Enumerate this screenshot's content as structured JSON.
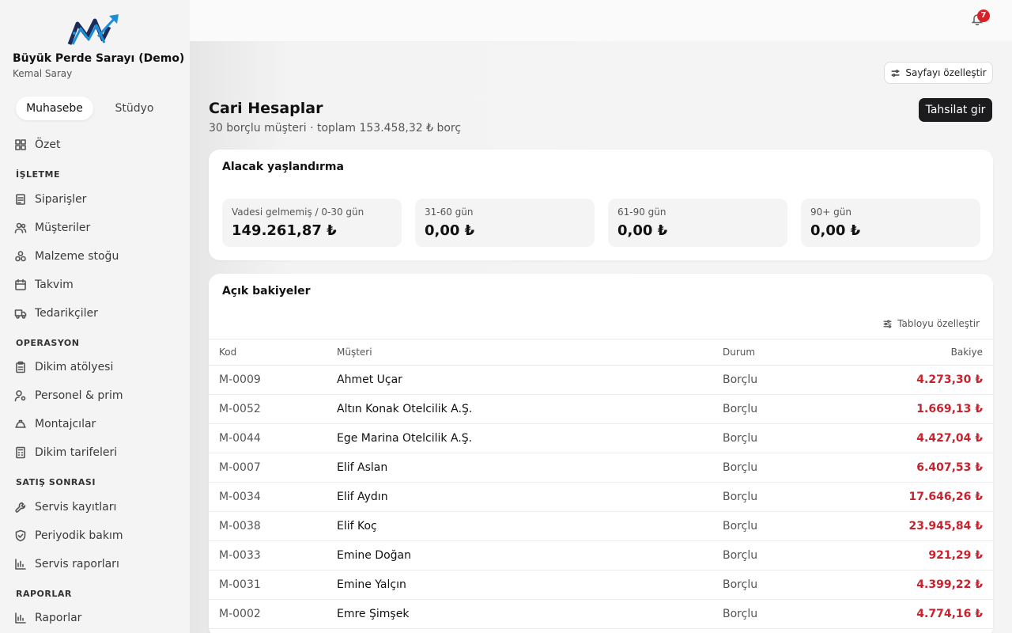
{
  "org": {
    "name": "Büyük Perde Sarayı (Demo)",
    "user": "Kemal Saray"
  },
  "segments": {
    "active": "Muhasebe",
    "inactive": "Stüdyo"
  },
  "nav": {
    "ozet": "Özet",
    "h1": "İŞLETME",
    "siparisler": "Siparişler",
    "musteriler": "Müşteriler",
    "malzeme": "Malzeme stoğu",
    "takvim": "Takvim",
    "tedarikciler": "Tedarikçiler",
    "h2": "OPERASYON",
    "dikim": "Dikim atölyesi",
    "personel": "Personel & prim",
    "montajcilar": "Montajcılar",
    "tarifeler": "Dikim tarifeleri",
    "h3": "SATIŞ SONRASI",
    "servis": "Servis kayıtları",
    "bakim": "Periyodik bakım",
    "raporlar_servis": "Servis raporları",
    "h4": "RAPORLAR",
    "raporlar": "Raporlar"
  },
  "notifications": {
    "count": "7"
  },
  "header": {
    "customize": "Sayfayı özelleştir",
    "title": "Cari Hesaplar",
    "subtitle": "30 borçlu müşteri · toplam 153.458,32 ₺ borç",
    "primary": "Tahsilat gir"
  },
  "aging": {
    "title": "Alacak yaşlandırma",
    "tiles": [
      {
        "label": "Vadesi gelmemiş / 0-30 gün",
        "value": "149.261,87 ₺"
      },
      {
        "label": "31-60 gün",
        "value": "0,00 ₺"
      },
      {
        "label": "61-90 gün",
        "value": "0,00 ₺"
      },
      {
        "label": "90+ gün",
        "value": "0,00 ₺"
      }
    ]
  },
  "balances": {
    "title": "Açık bakiyeler",
    "customize": "Tabloyu özelleştir",
    "columns": {
      "code": "Kod",
      "customer": "Müşteri",
      "status": "Durum",
      "balance": "Bakiye"
    },
    "rows": [
      {
        "code": "M-0009",
        "name": "Ahmet Uçar",
        "status": "Borçlu",
        "balance": "4.273,30 ₺"
      },
      {
        "code": "M-0052",
        "name": "Altın Konak Otelcilik A.Ş.",
        "status": "Borçlu",
        "balance": "1.669,13 ₺"
      },
      {
        "code": "M-0044",
        "name": "Ege Marina Otelcilik A.Ş.",
        "status": "Borçlu",
        "balance": "4.427,04 ₺"
      },
      {
        "code": "M-0007",
        "name": "Elif Aslan",
        "status": "Borçlu",
        "balance": "6.407,53 ₺"
      },
      {
        "code": "M-0034",
        "name": "Elif Aydın",
        "status": "Borçlu",
        "balance": "17.646,26 ₺"
      },
      {
        "code": "M-0038",
        "name": "Elif Koç",
        "status": "Borçlu",
        "balance": "23.945,84 ₺"
      },
      {
        "code": "M-0033",
        "name": "Emine Doğan",
        "status": "Borçlu",
        "balance": "921,29 ₺"
      },
      {
        "code": "M-0031",
        "name": "Emine Yalçın",
        "status": "Borçlu",
        "balance": "4.399,22 ₺"
      },
      {
        "code": "M-0002",
        "name": "Emre Şimşek",
        "status": "Borçlu",
        "balance": "4.774,16 ₺"
      }
    ]
  },
  "colors": {
    "accent": "#1c1c1e",
    "debt": "#c8222d",
    "badge": "#d92027",
    "logo_blue": "#1a8fd8",
    "logo_navy": "#1b2b5a"
  }
}
